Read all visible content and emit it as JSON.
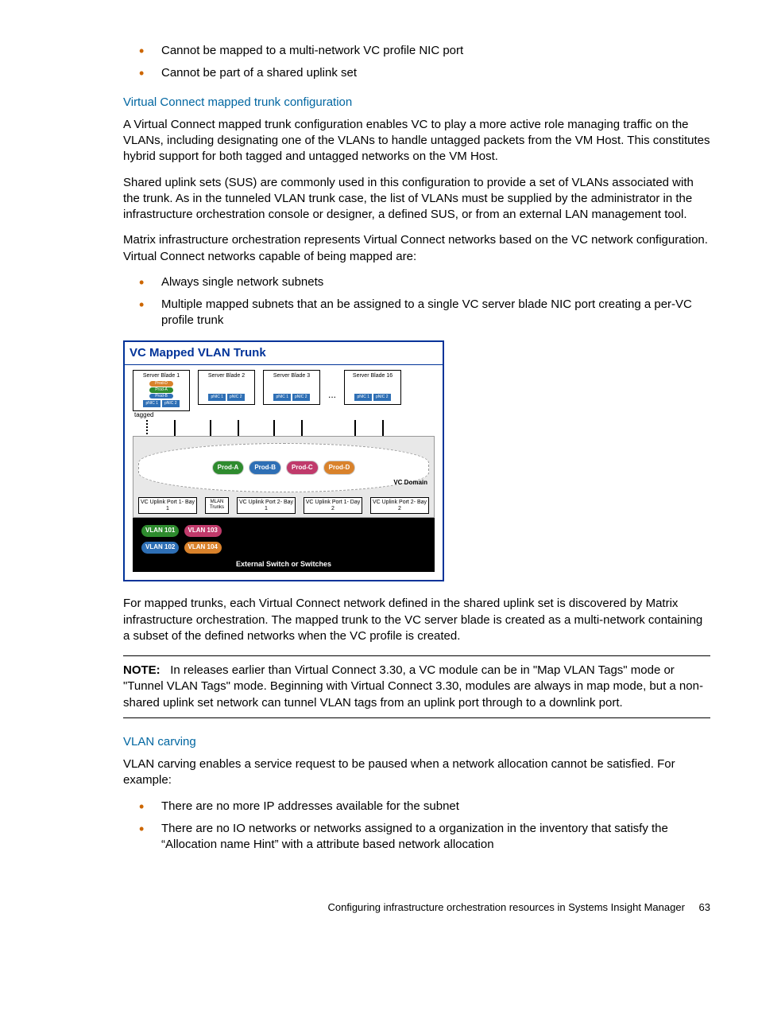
{
  "bullets_top": [
    "Cannot be mapped to a multi-network VC profile NIC port",
    "Cannot be part of a shared uplink set"
  ],
  "section1": {
    "heading": "Virtual Connect mapped trunk configuration",
    "p1": "A Virtual Connect mapped trunk configuration enables VC to play a more active role managing traffic on the VLANs, including designating one of the VLANs to handle untagged packets from the VM Host. This constitutes hybrid support for both tagged and untagged networks on the VM Host.",
    "p2": "Shared uplink sets (SUS) are commonly used in this configuration to provide a set of VLANs associated with the trunk. As in the tunneled VLAN trunk case, the list of VLANs must be supplied by the administrator in the infrastructure orchestration console or designer, a defined SUS, or from an external LAN management tool.",
    "p3": "Matrix infrastructure orchestration represents Virtual Connect networks based on the VC network configuration. Virtual Connect networks capable of being mapped are:",
    "bullets": [
      "Always single network subnets",
      "Multiple mapped subnets that an be assigned to a single VC server blade NIC port creating a per-VC profile trunk"
    ]
  },
  "diagram": {
    "title": "VC Mapped VLAN Trunk",
    "blades": [
      "Server Blade 1",
      "Server Blade 2",
      "Server Blade 3",
      "Server Blade 16"
    ],
    "nics": [
      "pNIC 1",
      "pNIC 2"
    ],
    "dots": "...",
    "tagged": "tagged",
    "clouds": {
      "a": "Prod-A",
      "b": "Prod-B",
      "c": "Prod-C",
      "d": "Prod-D"
    },
    "domain_label": "VC Domain",
    "uplinks": [
      "VC Uplink Port 1- Bay 1",
      "VC Uplink Port 2- Bay 1",
      "VC Uplink Port 1- Day 2",
      "VC Uplink Port 2- Bay 2"
    ],
    "mlan": "MLAN Trunks",
    "vlans": {
      "v101": "VLAN 101",
      "v102": "VLAN 102",
      "v103": "VLAN 103",
      "v104": "VLAN 104"
    },
    "switch_label": "External Switch or Switches"
  },
  "p_after_diagram": "For mapped trunks, each Virtual Connect network defined in the shared uplink set is discovered by Matrix infrastructure orchestration. The mapped trunk to the VC server blade is created as a multi-network containing a subset of the defined networks when the VC profile is created.",
  "note": {
    "label": "NOTE:",
    "text": "In releases earlier than Virtual Connect 3.30, a VC module can be in \"Map VLAN Tags\" mode or \"Tunnel VLAN Tags\" mode. Beginning with Virtual Connect 3.30, modules are always in map mode, but a non-shared uplink set network can tunnel VLAN tags from an uplink port through to a downlink port."
  },
  "section2": {
    "heading": "VLAN carving",
    "p1": "VLAN carving enables a service request to be paused when a network allocation cannot be satisfied. For example:",
    "bullets": [
      "There are no more IP addresses available for the subnet",
      "There are no IO networks or networks assigned to a organization in the inventory that satisfy the “Allocation name Hint” with a attribute based network allocation"
    ]
  },
  "footer": {
    "text": "Configuring infrastructure orchestration resources in Systems Insight Manager",
    "page": "63"
  }
}
